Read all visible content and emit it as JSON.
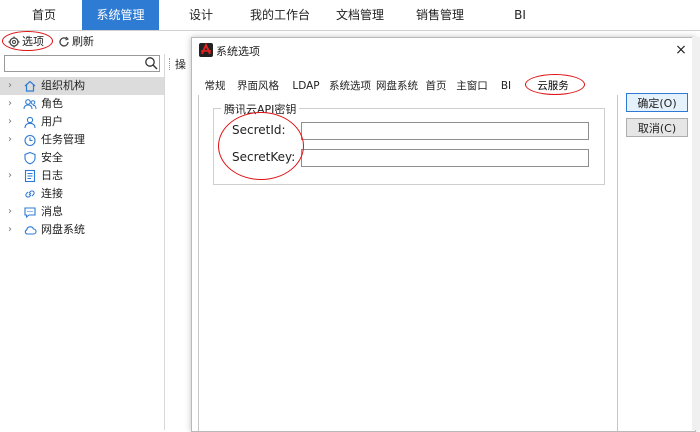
{
  "nav": {
    "items": [
      {
        "label": "首页"
      },
      {
        "label": "系统管理"
      },
      {
        "label": "设计"
      },
      {
        "label": "我的工作台"
      },
      {
        "label": "文档管理"
      },
      {
        "label": "销售管理"
      },
      {
        "label": "BI"
      }
    ],
    "active_index": 1
  },
  "toolbar": {
    "options_label": "选项",
    "refresh_label": "刷新",
    "ops_label": "操"
  },
  "search": {
    "value": "",
    "placeholder": ""
  },
  "tree": {
    "items": [
      {
        "label": "组织机构",
        "icon": "home-icon",
        "expandable": true
      },
      {
        "label": "角色",
        "icon": "users-icon",
        "expandable": true
      },
      {
        "label": "用户",
        "icon": "user-icon",
        "expandable": true
      },
      {
        "label": "任务管理",
        "icon": "clock-icon",
        "expandable": true
      },
      {
        "label": "安全",
        "icon": "shield-icon",
        "expandable": false
      },
      {
        "label": "日志",
        "icon": "log-icon",
        "expandable": true
      },
      {
        "label": "连接",
        "icon": "link-icon",
        "expandable": false
      },
      {
        "label": "消息",
        "icon": "message-icon",
        "expandable": true
      },
      {
        "label": "网盘系统",
        "icon": "cloud-icon",
        "expandable": true
      }
    ],
    "selected_index": 0
  },
  "dialog": {
    "title": "系统选项",
    "close_label": "×",
    "tabs": [
      {
        "label": "常规"
      },
      {
        "label": "界面风格"
      },
      {
        "label": "LDAP"
      },
      {
        "label": "系统选项"
      },
      {
        "label": "网盘系统"
      },
      {
        "label": "首页"
      },
      {
        "label": "主窗口"
      },
      {
        "label": "BI"
      },
      {
        "label": "云服务"
      }
    ],
    "active_tab_index": 8,
    "group_title": "腾讯云API密钥",
    "fields": [
      {
        "label": "SecretId:",
        "value": ""
      },
      {
        "label": "SecretKey:",
        "value": ""
      }
    ],
    "ok_label": "确定(O)",
    "cancel_label": "取消(C)"
  },
  "colors": {
    "nav_active_bg": "#2e7bd4",
    "highlight_circle": "#d11111",
    "selected_row_bg": "#dcdcdc"
  }
}
